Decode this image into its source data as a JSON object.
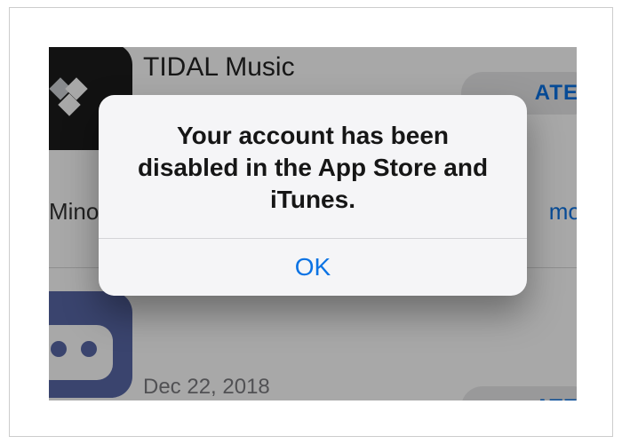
{
  "background": {
    "apps": [
      {
        "name_text": "TIDAL Music",
        "subline": "Mino",
        "update_label_fragment": "ATE",
        "more_label_fragment": "more"
      },
      {
        "date_text": "Dec 22, 2018",
        "update_label_fragment": "ATE"
      }
    ]
  },
  "alert": {
    "message": "Your account has been disabled in the App Store and iTunes.",
    "ok_label": "OK"
  }
}
